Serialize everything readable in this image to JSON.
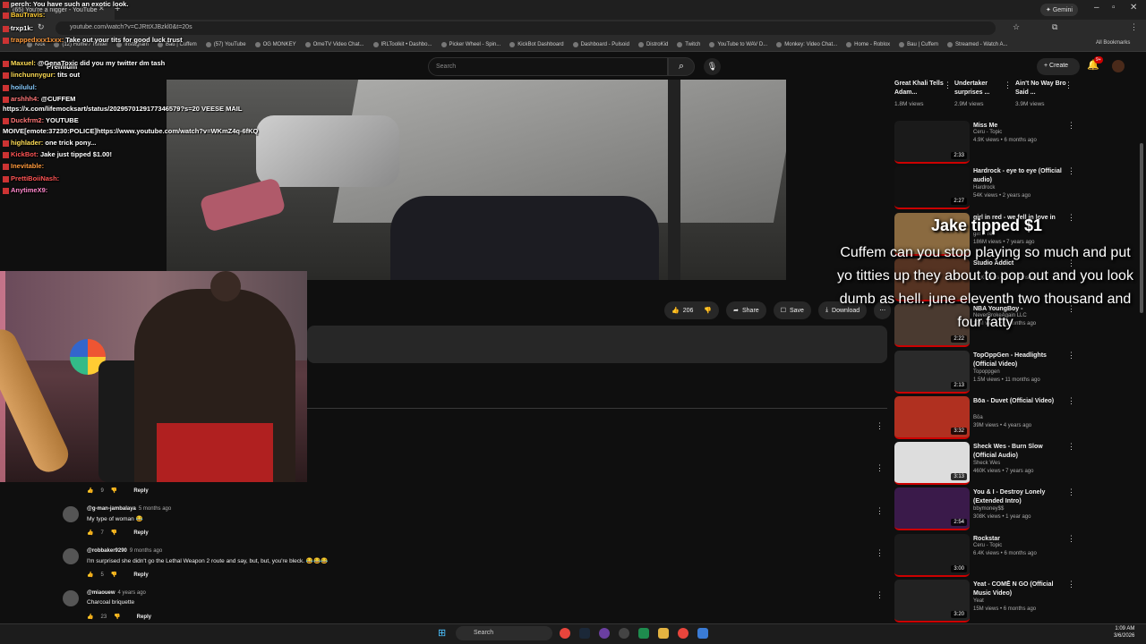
{
  "browser": {
    "tab_title": "(65) You're a nigger - YouTube",
    "url": "youtube.com/watch?v=CJRttXJBzkl0&t=20s",
    "gemini_label": "Gemini",
    "bookmarks": [
      "Kick",
      "(12) Home / Twitter",
      "Instagram",
      "Bau | Cuffem",
      "(57) YouTube",
      "OG MONKEY",
      "OmeTV Video Chat...",
      "IRLToolkit • Dashbo...",
      "Picker Wheel - Spin...",
      "KickBot Dashboard",
      "Dashboard - Pulsoid",
      "DistroKid",
      "Twitch",
      "YouTube to WAV D...",
      "Monkey: Video Chat...",
      "Home - Roblox",
      "Bau | Cuffem",
      "Streamed - Watch A..."
    ],
    "all_bookmarks": "All Bookmarks"
  },
  "yt": {
    "logo_text": "Premium",
    "search_placeholder": "Search",
    "create_label": "Create",
    "notif_badge": "9+"
  },
  "actions": {
    "like_count": "206",
    "share": "Share",
    "save": "Save",
    "download": "Download"
  },
  "comments": [
    {
      "user": "",
      "time": "",
      "text": "",
      "likes": "9",
      "reply": "Reply"
    },
    {
      "user": "@g-man-jambalaya",
      "time": "5 months ago",
      "text": "My type of woman 😂",
      "likes": "7",
      "reply": "Reply"
    },
    {
      "user": "@robbaker9290",
      "time": "9 months ago",
      "text": "I'm surprised she didn't go the Lethal Weapon 2 route and say, but, but, you're bleck. 😂😂😂",
      "likes": "5",
      "reply": "Reply"
    },
    {
      "user": "@miaouew",
      "time": "4 years ago",
      "text": "Charcoal briquette",
      "likes": "23",
      "reply": "Reply"
    }
  ],
  "shelf": [
    {
      "title": "Great Khali Tells Adam...",
      "views": "1.8M views"
    },
    {
      "title": "Undertaker surprises ...",
      "views": "2.9M views"
    },
    {
      "title": "Ain't No Way Bro Said ...",
      "views": "3.9M views"
    }
  ],
  "recs": [
    {
      "title": "Miss Me",
      "channel": "Ceru - Topic",
      "meta": "4.9K views • 6 months ago",
      "dur": "2:33",
      "color": "#1a1a1a"
    },
    {
      "title": "Hardrock - eye to eye (Official audio)",
      "channel": "Hardrock",
      "meta": "54K views • 2 years ago",
      "dur": "2:27",
      "color": "#111111"
    },
    {
      "title": "girl in red - we fell in love in",
      "channel": "girl in red",
      "meta": "186M views • 7 years ago",
      "dur": "",
      "color": "#8a6a40"
    },
    {
      "title": "Studio Addict",
      "channel": "",
      "meta": "2.2K views • 11 months ago",
      "dur": "",
      "color": "#553322"
    },
    {
      "title": "NBA YoungBoy -",
      "channel": "NeverBrokeAgain LLC",
      "meta": "17M views • 3 months ago",
      "dur": "2:22",
      "color": "#4a3a30"
    },
    {
      "title": "TopOppGen - Headlights (Official Video)",
      "channel": "Topoppgen",
      "meta": "1.5M views • 11 months ago",
      "dur": "2:13",
      "color": "#2a2a2a"
    },
    {
      "title": "Bōa - Duvet (Official Video)",
      "channel": "Bōa",
      "meta": "39M views • 4 years ago",
      "dur": "3:32",
      "color": "#b03020"
    },
    {
      "title": "Sheck Wes - Burn Slow (Official Audio)",
      "channel": "Sheck Wes",
      "meta": "460K views • 7 years ago",
      "dur": "3:13",
      "color": "#dddddd"
    },
    {
      "title": "You & I - Destroy Lonely (Extended Intro)",
      "channel": "bbymoney$$",
      "meta": "308K views • 1 year ago",
      "dur": "2:54",
      "color": "#3a1a4a"
    },
    {
      "title": "Rockstar",
      "channel": "Ceru - Topic",
      "meta": "6.4K views • 6 months ago",
      "dur": "3:00",
      "color": "#1a1a1a"
    },
    {
      "title": "Yeat - COMĒ N GO (Official Music Video)",
      "channel": "Yeat",
      "meta": "15M views • 6 months ago",
      "dur": "3:20",
      "color": "#222222"
    }
  ],
  "chat": [
    {
      "user": "perch:",
      "msg": "You have such an exotic look.",
      "color": "#ffffff"
    },
    {
      "user": "BauTravis:",
      "msg": "",
      "color": "#ffcc33"
    },
    {
      "user": "trxp1k:",
      "msg": "",
      "color": "#ffffff"
    },
    {
      "user": "trappedxxx1xxx:",
      "msg": "Take out your tits for good luck trust",
      "color": "#ff9a3c"
    },
    {
      "user": "Maxuel:",
      "msg": "@GenaToxic did you my twitter dm tash",
      "color": "#ffdd55"
    },
    {
      "user": "linchunnygur:",
      "msg": "tits out",
      "color": "#ffdd55"
    },
    {
      "user": "hoilulul:",
      "msg": "",
      "color": "#88ccff"
    },
    {
      "user": "arshhh4:",
      "msg": "@CUFFEM",
      "color": "#ff7777"
    },
    {
      "user": "",
      "msg": "https://x.com/lifemocksart/status/2029570129177346579?s=20 VEESE MAIL",
      "color": "#ffffff"
    },
    {
      "user": "Duckfrm2:",
      "msg": "YOUTUBE",
      "color": "#ff7777"
    },
    {
      "user": "",
      "msg": "MOIVE[emote:37230:POLICE]https://www.youtube.com/watch?v=WKmZ4q-6fKQ",
      "color": "#ffffff"
    },
    {
      "user": "highlader:",
      "msg": "one trick pony...",
      "color": "#ffdd55"
    },
    {
      "user": "KickBot:",
      "msg": "Jake just tipped $1.00!",
      "color": "#ff5555"
    },
    {
      "user": "Inevitable:",
      "msg": "",
      "color": "#ff9a3c"
    },
    {
      "user": "PrettiBoiiNash:",
      "msg": "",
      "color": "#ff5555"
    },
    {
      "user": "AnytimeX9:",
      "msg": "",
      "color": "#ff88cc"
    }
  ],
  "tip": {
    "title": "Jake tipped $1",
    "message": "Cuffem can you stop playing so much and put yo titties up they about to pop out and you look dumb as hell. june eleventh two thousand and four fatty"
  },
  "taskbar": {
    "search": "Search",
    "time": "1:09 AM",
    "date": "3/6/2026"
  }
}
